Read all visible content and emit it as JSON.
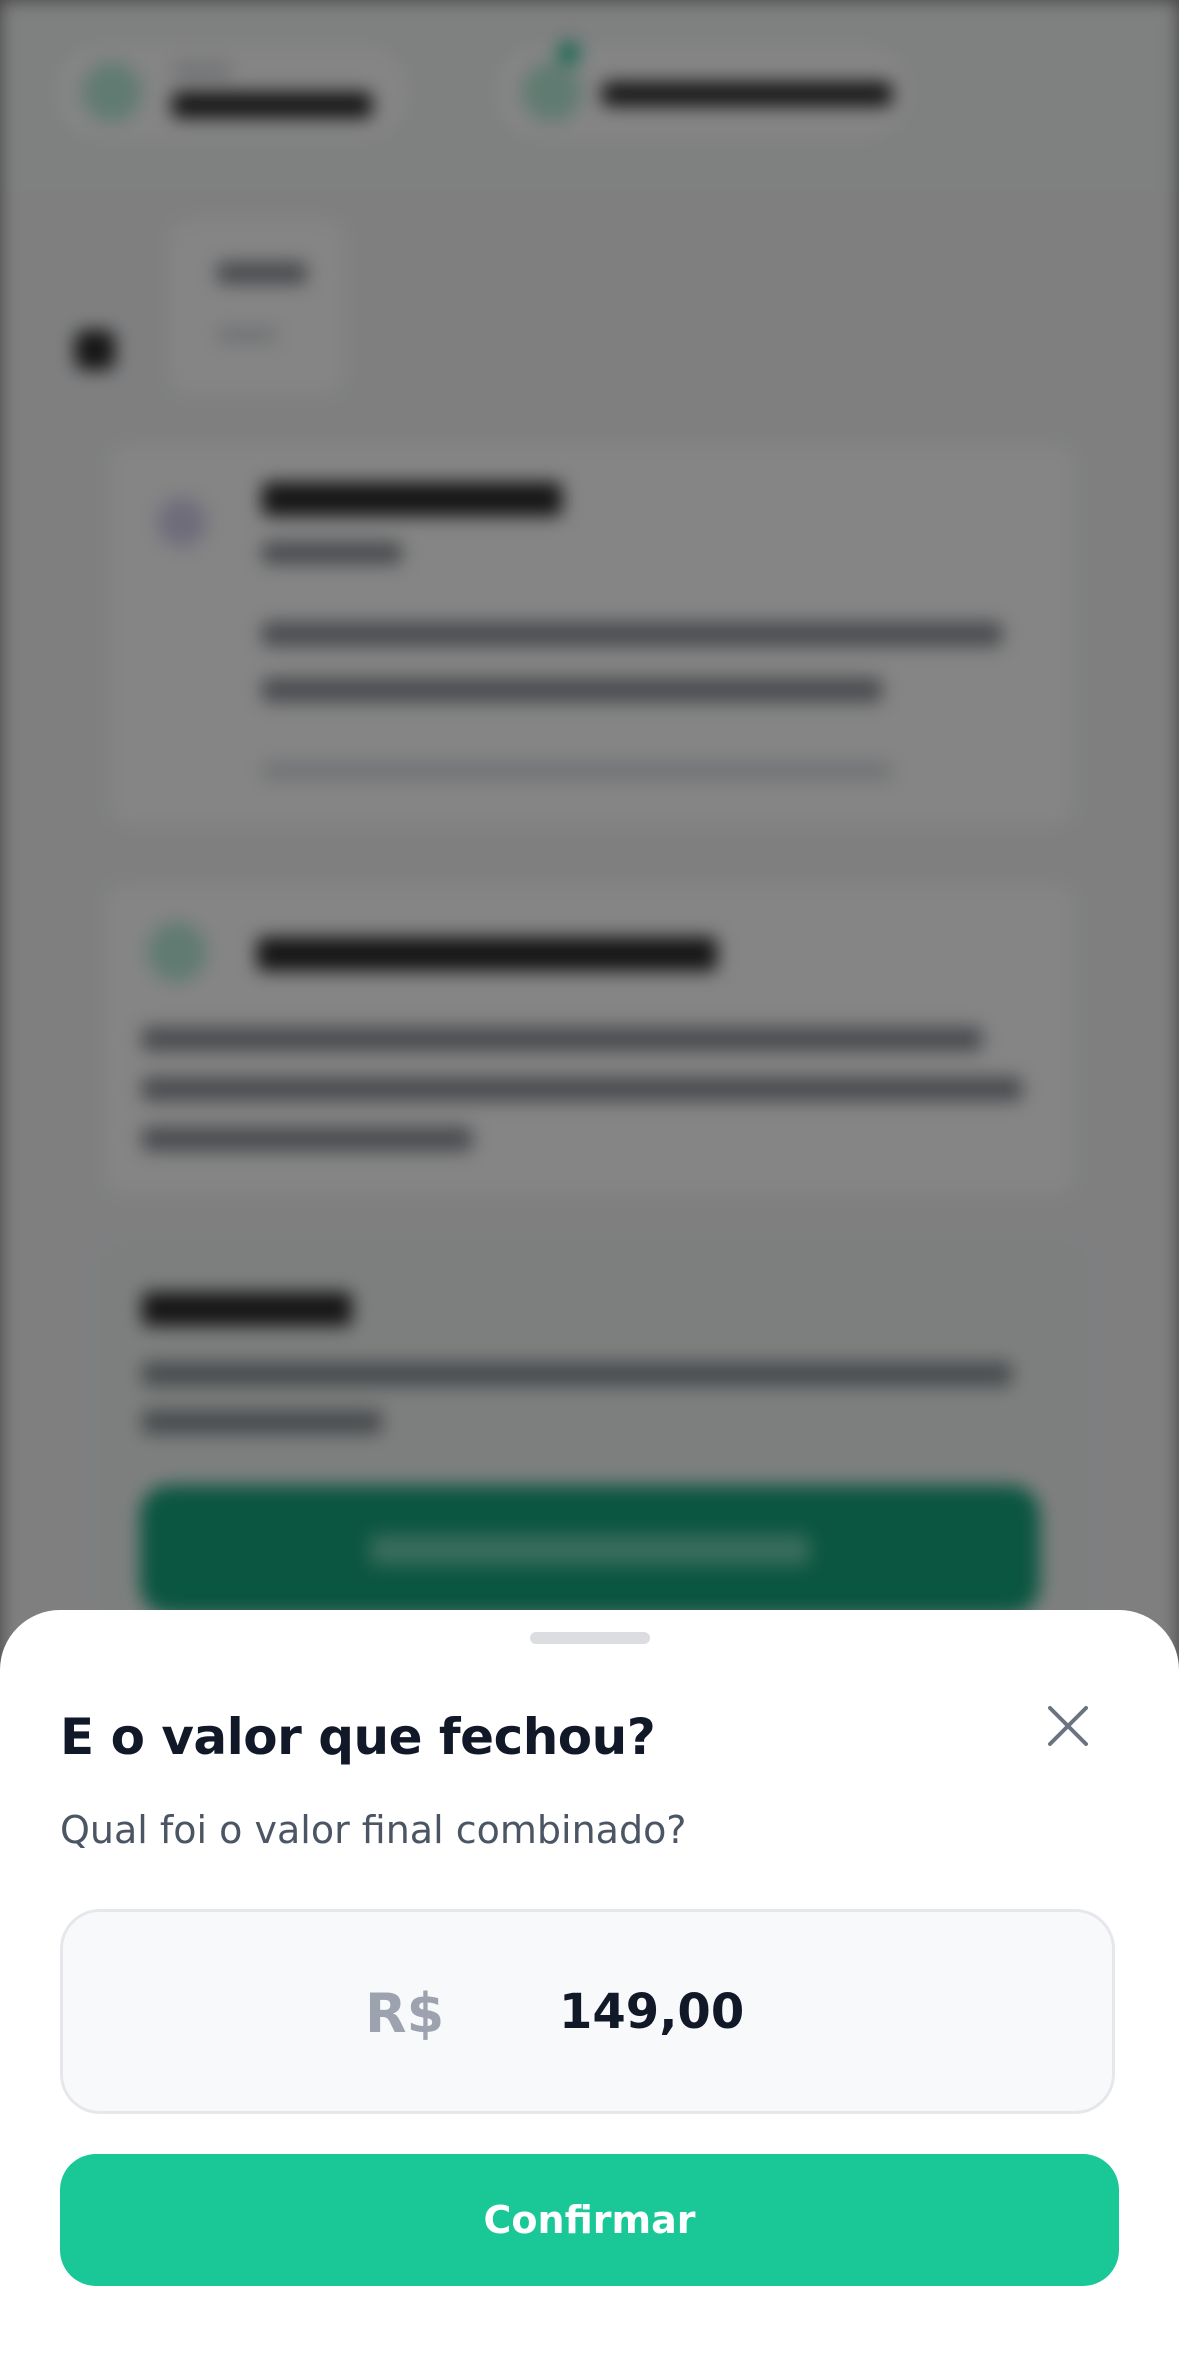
{
  "sheet": {
    "title": "E o valor que fechou?",
    "subtitle": "Qual foi o valor final combinado?",
    "amount": {
      "currency_symbol": "R$",
      "value": "149,00"
    },
    "confirm_label": "Confirmar",
    "close_icon": "close-icon"
  },
  "colors": {
    "accent": "#1ac897",
    "title": "#111827",
    "subtitle": "#4b5563",
    "currency": "#9ca3af"
  }
}
